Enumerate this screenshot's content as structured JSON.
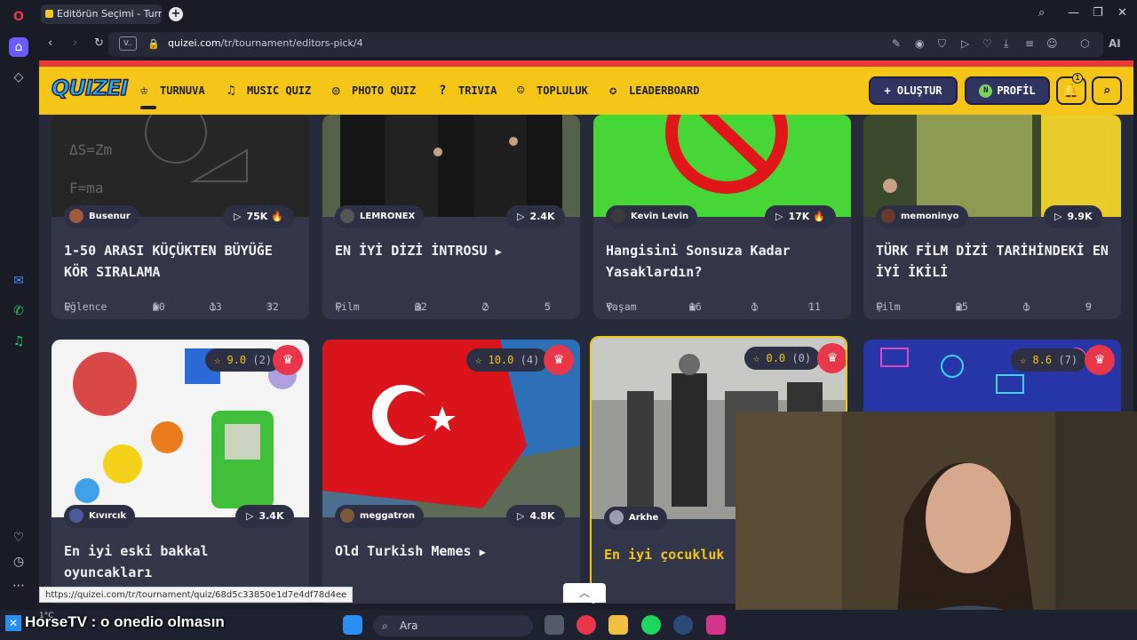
{
  "browser": {
    "tab_title": "Editörün Seçimi - Turnuva",
    "url_host": "quizei.com",
    "url_path": "/tr/tournament/editors-pick/4",
    "hover_url": "https://quizei.com/tr/tournament/quiz/68d5c33850e1d7e4df78d4ee"
  },
  "header": {
    "logo": "QUIZEI",
    "nav": [
      "TURNUVA",
      "MUSIC QUIZ",
      "PHOTO QUIZ",
      "TRIVIA",
      "TOPLULUK",
      "LEADERBOARD"
    ],
    "create_label": "+ OLUŞTUR",
    "profile_label": "PROFİL",
    "profile_initial": "N",
    "notif_count": "1"
  },
  "cards_top": [
    {
      "user": "Busenur",
      "plays": "75K",
      "title": "1-50 ARASI KÜÇÜKTEN BÜYÜĞE KÖR SIRALAMA",
      "category": "Eğlence",
      "items": "50",
      "comments": "13",
      "likes": "32"
    },
    {
      "user": "LEMRONEX",
      "plays": "2.4K",
      "title": "EN İYİ DİZİ İNTROSU",
      "category": "Film",
      "items": "32",
      "comments": "2",
      "likes": "5"
    },
    {
      "user": "Kevin Levin",
      "plays": "17K",
      "title": "Hangisini Sonsuza Kadar Yasaklardın?",
      "category": "Yaşam",
      "items": "16",
      "comments": "1",
      "likes": "11"
    },
    {
      "user": "memoninyo",
      "plays": "9.9K",
      "title": "TÜRK FİLM DİZİ TARİHİNDEKİ EN İYİ İKİLİ",
      "category": "Film",
      "items": "25",
      "comments": "1",
      "likes": "9"
    }
  ],
  "cards_bottom": [
    {
      "rating": "9.0",
      "count": "(2)",
      "user": "Kıvırcık",
      "plays": "3.4K",
      "title": "En iyi eski bakkal oyuncakları"
    },
    {
      "rating": "10.0",
      "count": "(4)",
      "user": "meggatron",
      "plays": "4.8K",
      "title": "Old Turkish Memes"
    },
    {
      "rating": "0.0",
      "count": "(0)",
      "user": "Arkhe",
      "plays": "",
      "title": "En iyi çocukluk"
    },
    {
      "rating": "8.6",
      "count": "(7)",
      "user": "",
      "plays": "",
      "title": ""
    }
  ],
  "taskbar": {
    "search_label": "Ara",
    "caption": "HorseTV : o onedio olmasın",
    "weather": "1°C"
  }
}
